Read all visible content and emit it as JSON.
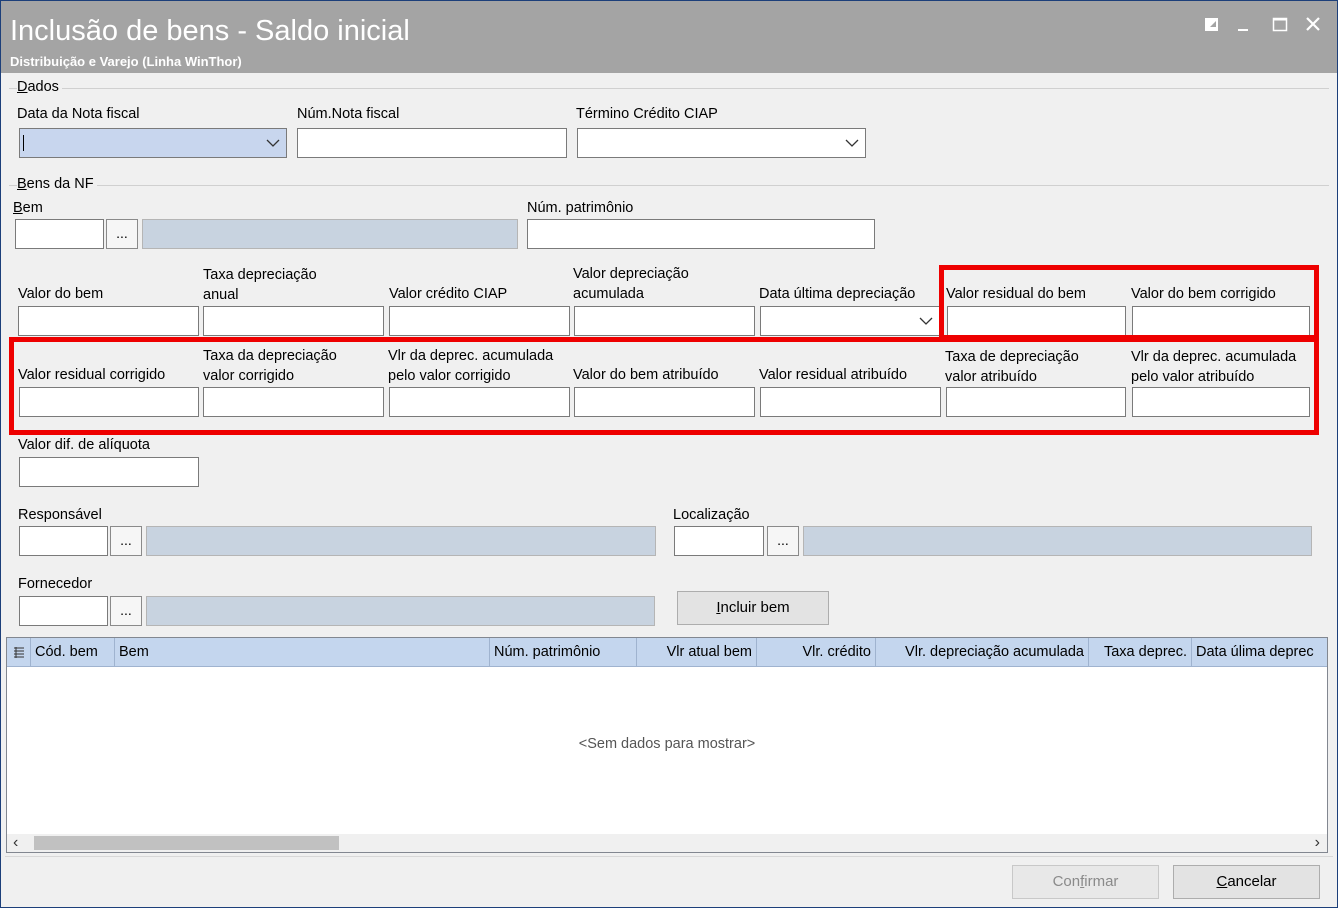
{
  "window": {
    "title": "Inclusão de bens - Saldo inicial",
    "subtitle": "Distribuição e Varejo (Linha WinThor)"
  },
  "dados": {
    "group_label": "Dados",
    "data_nota_fiscal_label": "Data da Nota fiscal",
    "data_nota_fiscal_value": "",
    "num_nota_fiscal_label": "Núm.Nota fiscal",
    "num_nota_fiscal_value": "",
    "termino_credito_ciap_label": "Término Crédito CIAP",
    "termino_credito_ciap_value": ""
  },
  "bens": {
    "group_label": "Bens da NF",
    "bem_label": "Bem",
    "bem_code_value": "",
    "bem_desc_value": "",
    "ellipsis": "...",
    "num_patrimonio_label": "Núm. patrimônio",
    "num_patrimonio_value": ""
  },
  "row1": {
    "valor_do_bem": "Valor do bem",
    "taxa_depreciacao_anual_1": "Taxa depreciação",
    "taxa_depreciacao_anual_2": "anual",
    "valor_credito_ciap": "Valor crédito CIAP",
    "valor_depreciacao_acumulada_1": "Valor depreciação",
    "valor_depreciacao_acumulada_2": "acumulada",
    "data_ultima_depreciacao": "Data última depreciação",
    "valor_residual_do_bem": "Valor residual do bem",
    "valor_do_bem_corrigido": "Valor do bem corrigido"
  },
  "row2": {
    "valor_residual_corrigido": "Valor residual corrigido",
    "taxa_depreciacao_valor_corrigido_1": "Taxa da depreciação",
    "taxa_depreciacao_valor_corrigido_2": "valor corrigido",
    "vlr_deprec_acum_corrigido_1": "Vlr da deprec. acumulada",
    "vlr_deprec_acum_corrigido_2": "pelo valor corrigido",
    "valor_do_bem_atribuido": "Valor do bem atribuído",
    "valor_residual_atribuido": "Valor residual atribuído",
    "taxa_depreciacao_valor_atribuido_1": "Taxa de depreciação",
    "taxa_depreciacao_valor_atribuido_2": "valor atribuído",
    "vlr_deprec_acum_atribuido_1": "Vlr da deprec. acumulada",
    "vlr_deprec_acum_atribuido_2": "pelo valor atribuído"
  },
  "row3": {
    "valor_dif_aliquota": "Valor dif. de alíquota"
  },
  "responsavel": {
    "label": "Responsável",
    "code": "",
    "desc": ""
  },
  "localizacao": {
    "label": "Localização",
    "code": "",
    "desc": ""
  },
  "fornecedor": {
    "label": "Fornecedor",
    "code": "",
    "desc": ""
  },
  "incluir_bem": {
    "accel": "I",
    "rest": "ncluir bem"
  },
  "grid": {
    "columns": [
      "Cód. bem",
      "Bem",
      "Núm. patrimônio",
      "Vlr atual bem",
      "Vlr. crédito",
      "Vlr. depreciação acumulada",
      "Taxa deprec.",
      "Data úlima deprec"
    ],
    "rows": [],
    "empty_text": "<Sem dados para mostrar>"
  },
  "footer": {
    "confirmar_a": "Con",
    "confirmar_accel": "f",
    "confirmar_b": "irmar",
    "cancelar_accel": "C",
    "cancelar_rest": "ancelar"
  },
  "colors": {
    "titlebar": "#a4a4a4",
    "highlight": "#ee0000",
    "grid_header": "#c4d6ee",
    "readonly_field": "#c8d3e0",
    "combo_selected": "#c8d6ee"
  },
  "icons": [
    "restore-icon",
    "minimize-icon",
    "maximize-icon",
    "close-icon",
    "chevron-down-icon",
    "grid-menu-icon",
    "scroll-left-icon",
    "scroll-right-icon"
  ]
}
